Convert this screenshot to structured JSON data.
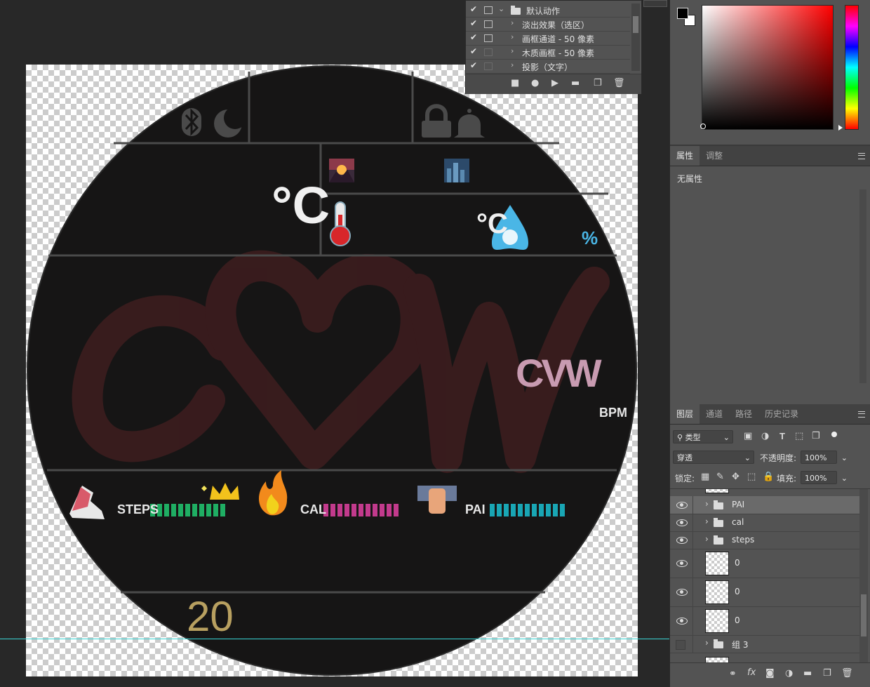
{
  "actions_panel": {
    "rows": [
      {
        "label": "默认动作",
        "checked": true,
        "dialog": true,
        "expanded": true,
        "icon": "folder-icon"
      },
      {
        "label": "淡出效果（选区）",
        "checked": true,
        "dialog": true
      },
      {
        "label": "画框通道 - 50 像素",
        "checked": true,
        "dialog": true
      },
      {
        "label": "木质画框 - 50 像素",
        "checked": true,
        "dialog": false
      },
      {
        "label": "投影（文字）",
        "checked": true,
        "dialog": false
      }
    ],
    "footer_icons": [
      "stop-icon",
      "record-icon",
      "play-icon",
      "new-set-icon",
      "new-action-icon",
      "trash-icon"
    ]
  },
  "watch_face": {
    "temp_unit": "°C",
    "humidity_unit": "°C",
    "percent": "%",
    "logo_text": "CVW",
    "bpm_label": "BPM",
    "steps_label": "STEPS",
    "cal_label": "CAL",
    "pai_label": "PAI",
    "day_number": "20",
    "colors": {
      "steps": "#1fae63",
      "cal": "#c23a8c",
      "pai": "#19a6b4",
      "logo": "#c89bb1",
      "day": "#b8a060",
      "watermark": "#3a1c1e"
    },
    "progress_segments": 11
  },
  "color_panel": {
    "foreground": "#000000",
    "background": "#ffffff",
    "hue": "#ff0000"
  },
  "properties_panel": {
    "tabs": [
      "属性",
      "调整"
    ],
    "active_tab": "属性",
    "empty_text": "无属性"
  },
  "layers_panel": {
    "tabs": [
      "图层",
      "通道",
      "路径",
      "历史记录"
    ],
    "active_tab": "图层",
    "filter_type": "类型",
    "blend_mode": "穿透",
    "opacity_label": "不透明度:",
    "opacity_value": "100%",
    "lock_label": "锁定:",
    "fill_label": "填充:",
    "fill_value": "100%",
    "layers": [
      {
        "name": "PAI",
        "kind": "group",
        "visible": true,
        "selected": true
      },
      {
        "name": "cal",
        "kind": "group",
        "visible": true
      },
      {
        "name": "steps",
        "kind": "group",
        "visible": true
      },
      {
        "name": "0",
        "kind": "layer",
        "visible": true
      },
      {
        "name": "0",
        "kind": "layer",
        "visible": true
      },
      {
        "name": "0",
        "kind": "layer",
        "visible": true
      },
      {
        "name": "组 3",
        "kind": "group",
        "visible": false
      }
    ],
    "footer_icons": [
      "link-icon",
      "fx-icon",
      "mask-icon",
      "adjustment-icon",
      "group-icon",
      "new-layer-icon",
      "trash-icon"
    ]
  }
}
